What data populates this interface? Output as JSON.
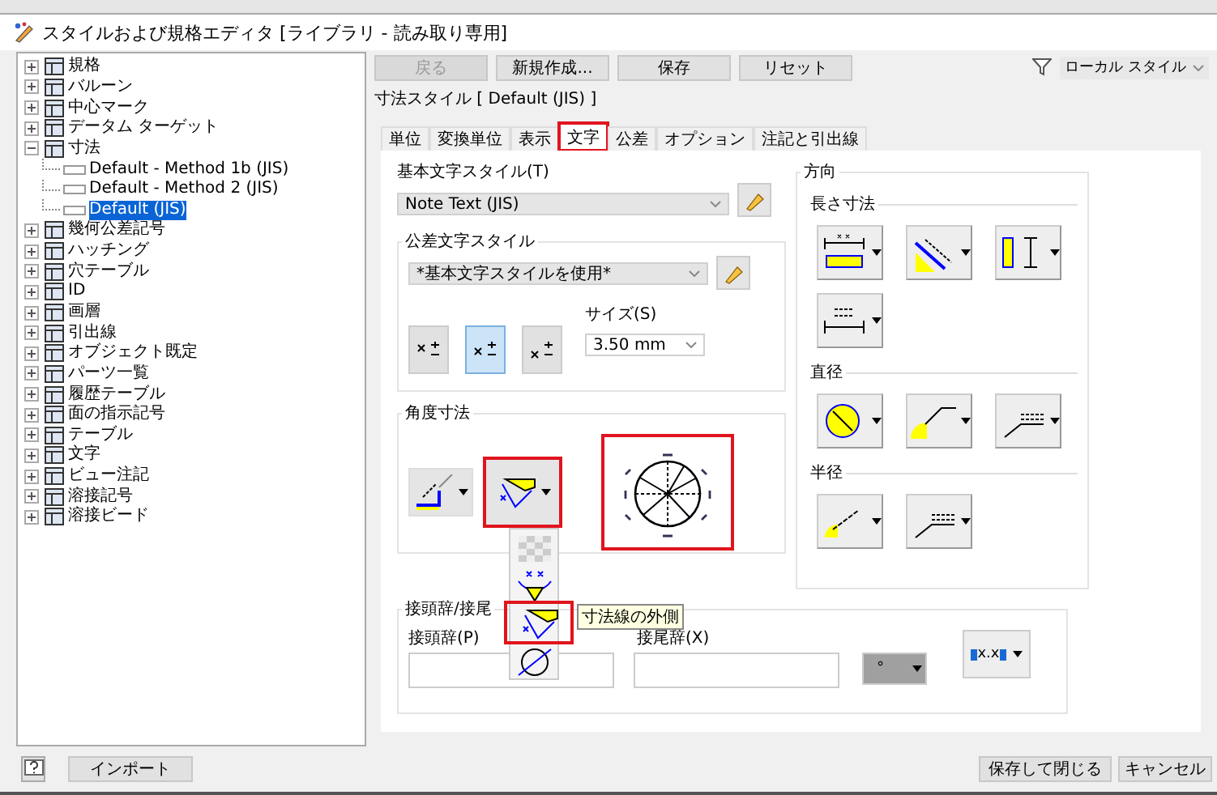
{
  "window": {
    "title": "スタイルおよび規格エディタ [ライブラリ - 読み取り専用]"
  },
  "tree": {
    "items": [
      {
        "label": "規格",
        "expanded": false,
        "selected": false
      },
      {
        "label": "バルーン",
        "expanded": false,
        "selected": false
      },
      {
        "label": "中心マーク",
        "expanded": false,
        "selected": false
      },
      {
        "label": "データム ターゲット",
        "expanded": false,
        "selected": false
      },
      {
        "label": "寸法",
        "expanded": true,
        "selected": false,
        "children": [
          {
            "label": "Default - Method 1b (JIS)",
            "selected": false
          },
          {
            "label": "Default - Method 2 (JIS)",
            "selected": false
          },
          {
            "label": "Default (JIS)",
            "selected": true
          }
        ]
      },
      {
        "label": "幾何公差記号",
        "expanded": false,
        "selected": false
      },
      {
        "label": "ハッチング",
        "expanded": false,
        "selected": false
      },
      {
        "label": "穴テーブル",
        "expanded": false,
        "selected": false
      },
      {
        "label": "ID",
        "expanded": false,
        "selected": false
      },
      {
        "label": "画層",
        "expanded": false,
        "selected": false
      },
      {
        "label": "引出線",
        "expanded": false,
        "selected": false
      },
      {
        "label": "オブジェクト既定",
        "expanded": false,
        "selected": false
      },
      {
        "label": "パーツ一覧",
        "expanded": false,
        "selected": false
      },
      {
        "label": "履歴テーブル",
        "expanded": false,
        "selected": false
      },
      {
        "label": "面の指示記号",
        "expanded": false,
        "selected": false
      },
      {
        "label": "テーブル",
        "expanded": false,
        "selected": false
      },
      {
        "label": "文字",
        "expanded": false,
        "selected": false
      },
      {
        "label": "ビュー注記",
        "expanded": false,
        "selected": false
      },
      {
        "label": "溶接記号",
        "expanded": false,
        "selected": false
      },
      {
        "label": "溶接ビード",
        "expanded": false,
        "selected": false
      }
    ]
  },
  "toolbar": {
    "buttons": [
      {
        "label": "戻る",
        "disabled": true
      },
      {
        "label": "新規作成...",
        "disabled": false
      },
      {
        "label": "保存",
        "disabled": false
      },
      {
        "label": "リセット",
        "disabled": false
      }
    ],
    "filter": {
      "value": "ローカル スタイル"
    }
  },
  "style_heading": "寸法スタイル [ Default (JIS) ]",
  "tabs": [
    {
      "label": "単位",
      "selected": false,
      "annotated": false
    },
    {
      "label": "変換単位",
      "selected": false,
      "annotated": false
    },
    {
      "label": "表示",
      "selected": false,
      "annotated": false
    },
    {
      "label": "文字",
      "selected": true,
      "annotated": true
    },
    {
      "label": "公差",
      "selected": false,
      "annotated": false
    },
    {
      "label": "オプション",
      "selected": false,
      "annotated": false
    },
    {
      "label": "注記と引出線",
      "selected": false,
      "annotated": false
    }
  ],
  "text_tab": {
    "base_text_style": {
      "label": "基本文字スタイル(T)",
      "value": "Note Text (JIS)"
    },
    "tolerance_text_style": {
      "title": "公差文字スタイル",
      "value": "*基本文字スタイルを使用*",
      "formats": [
        {
          "selected": false
        },
        {
          "selected": true
        },
        {
          "selected": false
        }
      ],
      "size_label": "サイズ(S)",
      "size_value": "3.50 mm"
    },
    "angular": {
      "title": "角度寸法",
      "style_button_annotated": true,
      "preview_annotated": true,
      "menu": {
        "items": [
          {
            "kind": "blank",
            "annotated": false
          },
          {
            "kind": "above",
            "annotated": false
          },
          {
            "kind": "outside",
            "annotated": true
          },
          {
            "kind": "inline",
            "annotated": false
          }
        ]
      },
      "tooltip": "寸法線の外側"
    },
    "affix": {
      "title": "接頭辞/接尾",
      "prefix_label": "接頭辞(P)",
      "suffix_label": "接尾辞(X)",
      "symbol": "°",
      "format_label": "x.x"
    },
    "orientation": {
      "title": "方向",
      "linear_title": "長さ寸法",
      "diameter_title": "直径",
      "radius_title": "半径"
    }
  },
  "footer": {
    "import_button": "インポート",
    "save_close_button": "保存して閉じる",
    "cancel_button": "キャンセル"
  }
}
